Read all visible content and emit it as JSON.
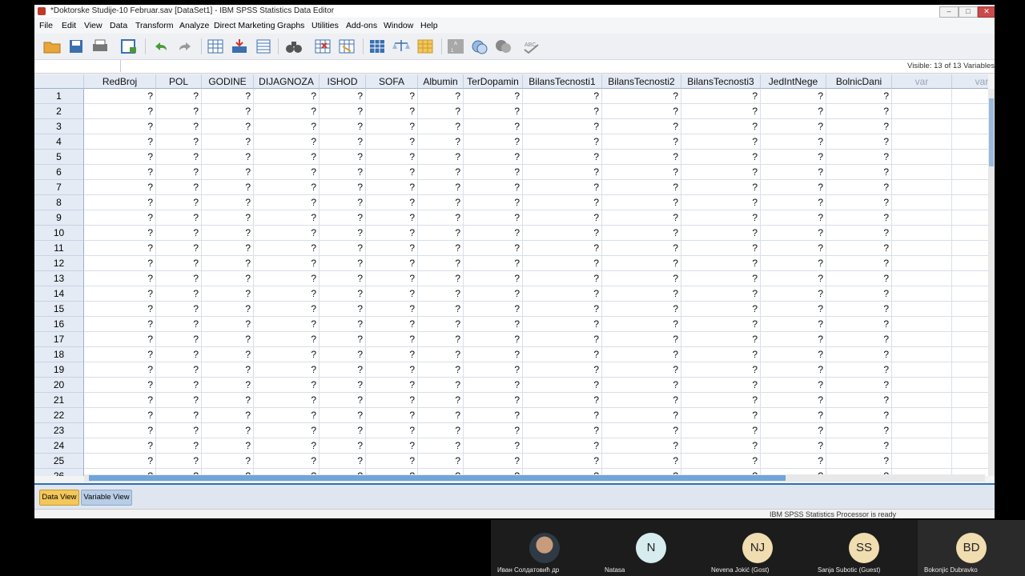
{
  "window": {
    "title": "*Doktorske Studije-10 Februar.sav [DataSet1] - IBM SPSS Statistics Data Editor"
  },
  "menu": [
    "File",
    "Edit",
    "View",
    "Data",
    "Transform",
    "Analyze",
    "Direct Marketing",
    "Graphs",
    "Utilities",
    "Add-ons",
    "Window",
    "Help"
  ],
  "cell_editor": {
    "visible_text": "Visible: 13 of 13 Variables"
  },
  "grid": {
    "columns": [
      "RedBroj",
      "POL",
      "GODINE",
      "DIJAGNOZA",
      "ISHOD",
      "SOFA",
      "Albumin",
      "TerDopamin",
      "BilansTecnosti1",
      "BilansTecnosti2",
      "BilansTecnosti3",
      "JedIntNege",
      "BolnicDani",
      "var",
      "var"
    ],
    "rows": [
      "1",
      "2",
      "3",
      "4",
      "5",
      "6",
      "7",
      "8",
      "9",
      "10",
      "11",
      "12",
      "13",
      "14",
      "15",
      "16",
      "17",
      "18",
      "19",
      "20",
      "21",
      "22",
      "23",
      "24",
      "25",
      "26"
    ],
    "cell_value": "?"
  },
  "tabs": {
    "data_view": "Data View",
    "variable_view": "Variable View"
  },
  "status": {
    "processor": "IBM SPSS Statistics Processor is ready"
  },
  "participants": [
    {
      "initials": "",
      "name": "Иван Солдатовић др"
    },
    {
      "initials": "N",
      "name": "Natasa"
    },
    {
      "initials": "NJ",
      "name": "Nevena Jokić (Gost)"
    },
    {
      "initials": "SS",
      "name": "Sanja Subotic (Guest)"
    },
    {
      "initials": "BD",
      "name": "Bokonjic Dubravko"
    }
  ]
}
